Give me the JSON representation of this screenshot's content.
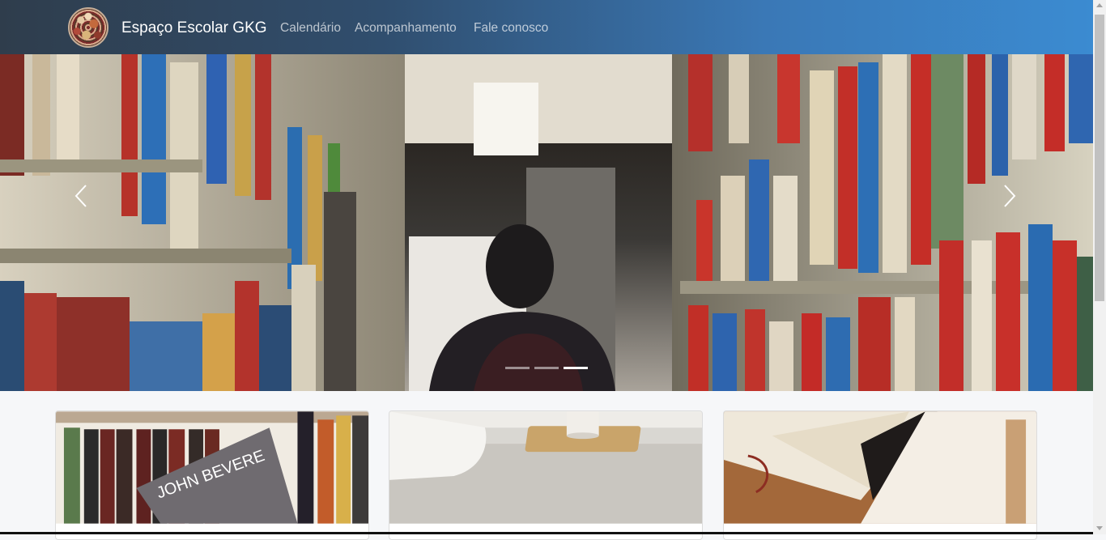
{
  "navbar": {
    "brand": "Espaço Escolar GKG",
    "logo_icon": "school-logo",
    "links": [
      {
        "label": "Calendário"
      },
      {
        "label": "Acompanhamento"
      },
      {
        "label": "Fale conosco"
      }
    ],
    "colors": {
      "start": "#2f3d4c",
      "end": "#3b8bd1"
    }
  },
  "carousel": {
    "image": "library-aisle-photo",
    "prev_icon": "chevron-left-icon",
    "next_icon": "chevron-right-icon",
    "slides_total": 3,
    "active_slide": 3
  },
  "cards": [
    {
      "image": "bookshelf-john-bevere-photo",
      "book_title": "JOHN BEVERE"
    },
    {
      "image": "bed-tray-coffee-photo"
    },
    {
      "image": "open-bible-photo"
    }
  ]
}
